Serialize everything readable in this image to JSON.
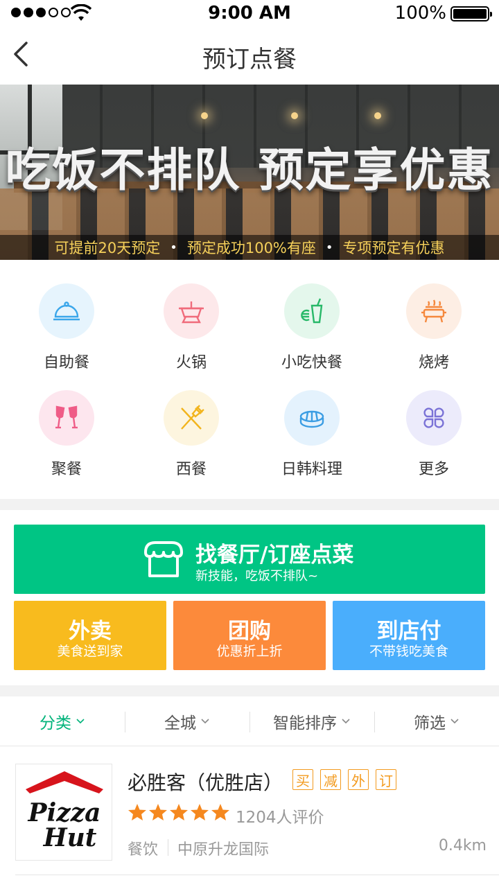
{
  "status_bar": {
    "time": "9:00 AM",
    "battery": "100%"
  },
  "nav": {
    "title": "预订点餐"
  },
  "banner": {
    "headline": "吃饭不排队 预定享优惠",
    "tags": [
      "可提前20天预定",
      "预定成功100%有座",
      "专项预定有优惠"
    ]
  },
  "categories": [
    {
      "label": "自助餐",
      "icon": "cloche-icon",
      "bg": "#e6f4fd",
      "color": "#3aa6ea"
    },
    {
      "label": "火锅",
      "icon": "hotpot-icon",
      "bg": "#fde8ea",
      "color": "#f06b7b"
    },
    {
      "label": "小吃快餐",
      "icon": "fastfood-icon",
      "bg": "#e4f7ec",
      "color": "#27b868"
    },
    {
      "label": "烧烤",
      "icon": "bbq-icon",
      "bg": "#fdeee4",
      "color": "#f5883d"
    },
    {
      "label": "聚餐",
      "icon": "champagne-icon",
      "bg": "#fde6ee",
      "color": "#ef5c87"
    },
    {
      "label": "西餐",
      "icon": "fork-knife-icon",
      "bg": "#fdf5df",
      "color": "#f2b41c"
    },
    {
      "label": "日韩料理",
      "icon": "sushi-icon",
      "bg": "#e4f2fd",
      "color": "#3b9de3"
    },
    {
      "label": "更多",
      "icon": "more-icon",
      "bg": "#ecebfb",
      "color": "#7a72d6"
    }
  ],
  "find_card": {
    "title": "找餐厅/订座点菜",
    "subtitle": "新技能，吃饭不排队~",
    "color": "#00c584"
  },
  "tiles": [
    {
      "title": "外卖",
      "subtitle": "美食送到家",
      "color": "#f8bb1e"
    },
    {
      "title": "团购",
      "subtitle": "优惠折上折",
      "color": "#fc8a3b"
    },
    {
      "title": "到店付",
      "subtitle": "不带钱吃美食",
      "color": "#4aaefc"
    }
  ],
  "filters": [
    "分类",
    "全城",
    "智能排序",
    "筛选"
  ],
  "restaurant": {
    "name": "必胜客（优胜店）",
    "tags": [
      "买",
      "减",
      "外",
      "订"
    ],
    "rating": 5,
    "reviews": "1204人评价",
    "cuisine": "餐饮",
    "area": "中原升龙国际",
    "distance": "0.4km",
    "logo_text_1": "Pizza",
    "logo_text_2": "Hut"
  }
}
